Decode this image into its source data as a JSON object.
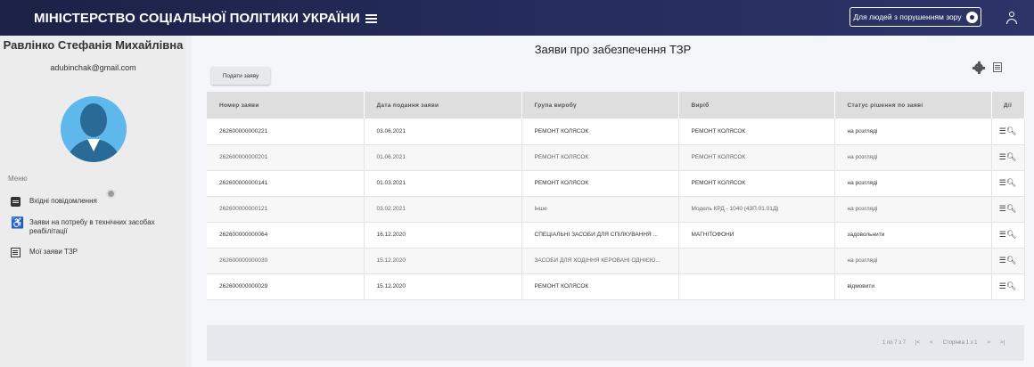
{
  "header": {
    "title": "МІНІСТЕРСТВО СОЦІАЛЬНОЇ ПОЛІТИКИ УКРАЇНИ",
    "vision_button": "Для людей з порушенням зору"
  },
  "sidebar": {
    "user_name": "Равлінко Стефанія Михайлівна",
    "email": "adubinchak@gmail.com",
    "menu_title": "Меню",
    "items": [
      {
        "label": "Вхідні повідомлення",
        "icon": "message-icon"
      },
      {
        "label": "Заяви на потребу в технічних засобах реабілітації",
        "icon": "wheelchair-icon"
      },
      {
        "label": "Мої заяви ТЗР",
        "icon": "document-icon"
      }
    ]
  },
  "main": {
    "title": "Заяви про забезпечення ТЗР",
    "submit_button": "Подати заяву",
    "columns": [
      "Номер заяви",
      "Дата подання заяви",
      "Група виробу",
      "Виріб",
      "Статус рішення по заяві",
      "Дії"
    ],
    "rows": [
      [
        "262600000000221",
        "03.06.2021",
        "РЕМОНТ КОЛЯСОК",
        "РЕМОНТ КОЛЯСОК",
        "на розгляді"
      ],
      [
        "262600000000201",
        "01.06.2021",
        "РЕМОНТ КОЛЯСОК",
        "РЕМОНТ КОЛЯСОК",
        "на розгляді"
      ],
      [
        "262600000000141",
        "01.03.2021",
        "РЕМОНТ КОЛЯСОК",
        "РЕМОНТ КОЛЯСОК",
        "на розгляді"
      ],
      [
        "262600000000121",
        "03.02.2021",
        "Інше",
        "Модель КРД - 1040 (43П.01.01Д)",
        "на розгляді"
      ],
      [
        "262600000000064",
        "16.12.2020",
        "СПЕЦІАЛЬНІ ЗАСОБИ ДЛЯ СПІЛКУВАННЯ ...",
        "МАГНІТОФОНИ",
        "задовольнити"
      ],
      [
        "262600000000030",
        "15.12.2020",
        "ЗАСОБИ ДЛЯ ХОДІННЯ КЕРОВАНІ ОДНІЄЮ...",
        "",
        "на розгляді"
      ],
      [
        "262600000000029",
        "15.12.2020",
        "РЕМОНТ КОЛЯСОК",
        "",
        "відмовити"
      ]
    ],
    "pagination": {
      "range": "1 по 7 з 7",
      "first": "|<",
      "prev": "<",
      "page_label": "Сторінка 1 з 1",
      "next": ">",
      "last": ">|"
    }
  },
  "colors": {
    "header_bg": "#262c5c",
    "avatar_bg": "#5fb8ec",
    "avatar_fg": "#2a6a96"
  }
}
